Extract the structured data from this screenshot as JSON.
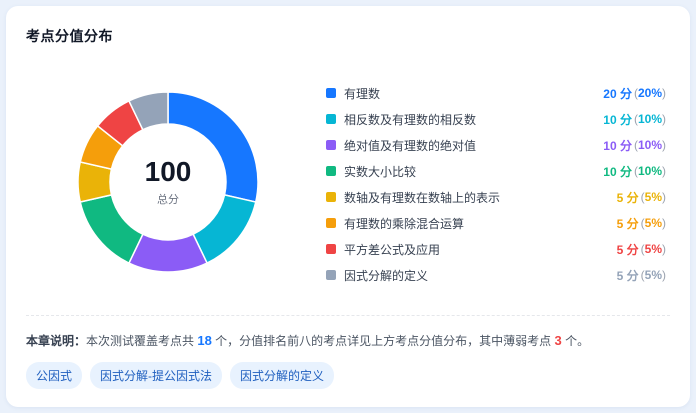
{
  "title": "考点分值分布",
  "center": {
    "total": "100",
    "unit": "总分"
  },
  "chart_data": {
    "type": "pie",
    "categories": [
      "有理数",
      "相反数及有理数的相反数",
      "绝对值及有理数的绝对值",
      "实数大小比较",
      "数轴及有理数在数轴上的表示",
      "有理数的乘除混合运算",
      "平方差公式及应用",
      "因式分解的定义"
    ],
    "values": [
      20,
      10,
      10,
      10,
      5,
      5,
      5,
      5
    ],
    "colors": [
      "#1677ff",
      "#06b6d4",
      "#8b5cf6",
      "#10b981",
      "#eab308",
      "#f59e0b",
      "#ef4444",
      "#94a3b8"
    ]
  },
  "legend": [
    {
      "name": "有理数",
      "score": "20 分",
      "pct": "20%",
      "color": "#1677ff"
    },
    {
      "name": "相反数及有理数的相反数",
      "score": "10 分",
      "pct": "10%",
      "color": "#06b6d4"
    },
    {
      "name": "绝对值及有理数的绝对值",
      "score": "10 分",
      "pct": "10%",
      "color": "#8b5cf6"
    },
    {
      "name": "实数大小比较",
      "score": "10 分",
      "pct": "10%",
      "color": "#10b981"
    },
    {
      "name": "数轴及有理数在数轴上的表示",
      "score": "5 分",
      "pct": "5%",
      "color": "#eab308"
    },
    {
      "name": "有理数的乘除混合运算",
      "score": "5 分",
      "pct": "5%",
      "color": "#f59e0b"
    },
    {
      "name": "平方差公式及应用",
      "score": "5 分",
      "pct": "5%",
      "color": "#ef4444"
    },
    {
      "name": "因式分解的定义",
      "score": "5 分",
      "pct": "5%",
      "color": "#94a3b8"
    }
  ],
  "note": {
    "label": "本章说明：",
    "text1": "本次测试覆盖考点共 ",
    "count": "18",
    "text2": " 个，分值排名前八的考点详见上方考点分值分布，其中薄弱考点 ",
    "weak": "3",
    "text3": " 个。"
  },
  "tags": [
    "公因式",
    "因式分解-提公因式法",
    "因式分解的定义"
  ]
}
